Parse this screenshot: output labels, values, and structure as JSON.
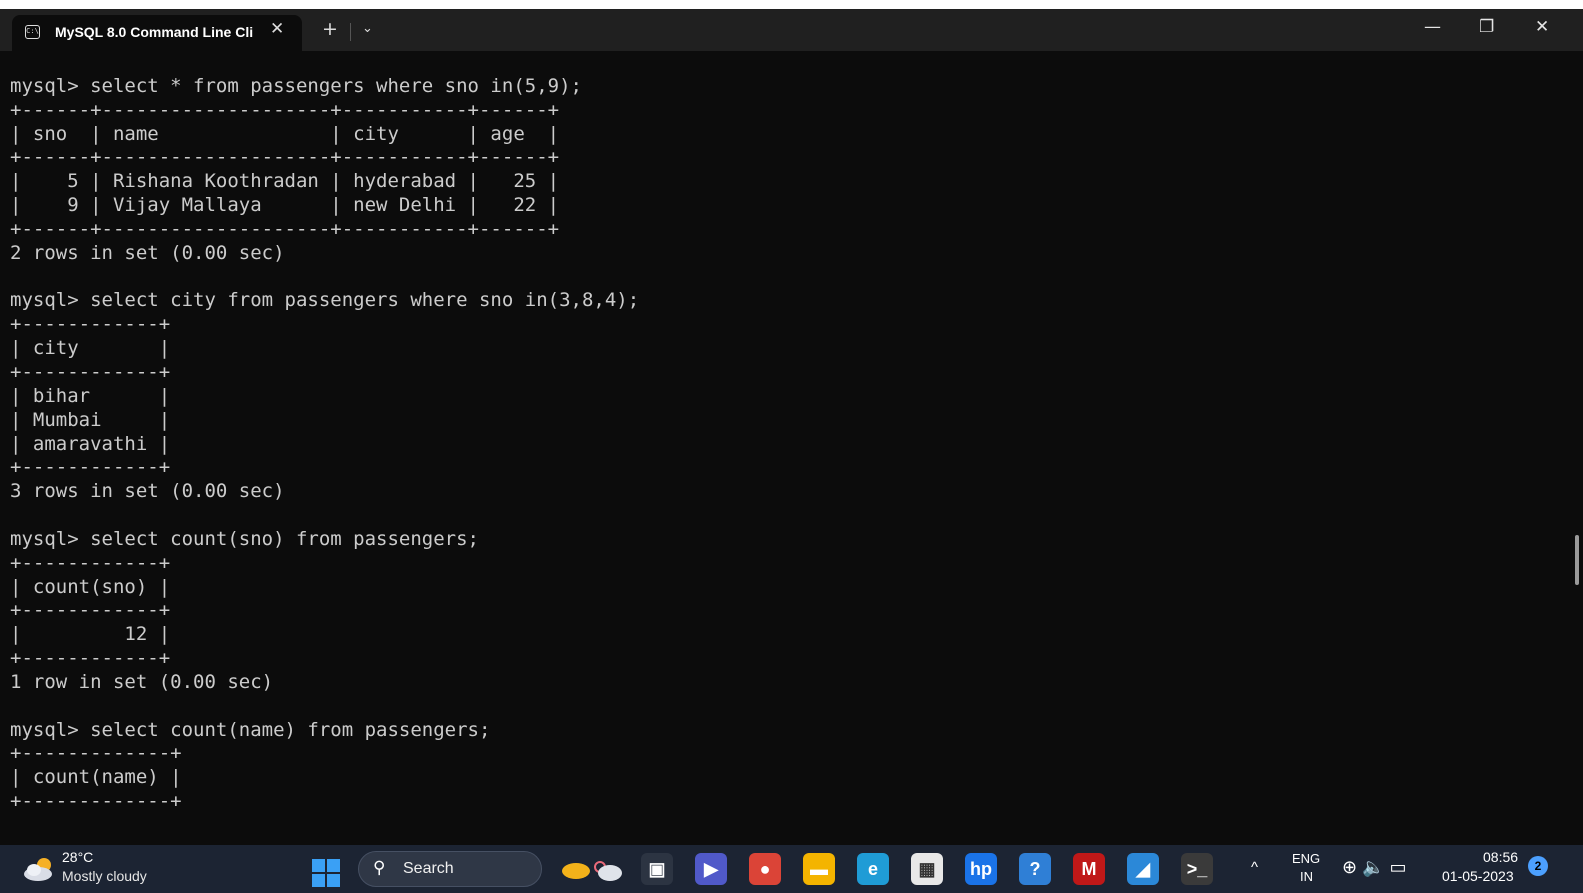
{
  "window": {
    "tab_title": "MySQL 8.0 Command Line Cli",
    "tab_close_glyph": "✕",
    "new_tab_glyph": "+",
    "dropdown_glyph": "⌄",
    "minimize_glyph": "—",
    "restore_glyph": "❐",
    "close_glyph": "✕"
  },
  "terminal": {
    "lines": [
      "",
      "mysql> select * from passengers where sno in(5,9);",
      "+------+--------------------+-----------+------+",
      "| sno  | name               | city      | age  |",
      "+------+--------------------+-----------+------+",
      "|    5 | Rishana Koothradan | hyderabad |   25 |",
      "|    9 | Vijay Mallaya      | new Delhi |   22 |",
      "+------+--------------------+-----------+------+",
      "2 rows in set (0.00 sec)",
      "",
      "mysql> select city from passengers where sno in(3,8,4);",
      "+------------+",
      "| city       |",
      "+------------+",
      "| bihar      |",
      "| Mumbai     |",
      "| amaravathi |",
      "+------------+",
      "3 rows in set (0.00 sec)",
      "",
      "mysql> select count(sno) from passengers;",
      "+------------+",
      "| count(sno) |",
      "+------------+",
      "|         12 |",
      "+------------+",
      "1 row in set (0.00 sec)",
      "",
      "mysql> select count(name) from passengers;",
      "+-------------+",
      "| count(name) |",
      "+-------------+"
    ]
  },
  "taskbar": {
    "weather_temp": "28°C",
    "weather_condition": "Mostly cloudy",
    "search_label": "Search",
    "search_glyph": "⚲",
    "language_top": "ENG",
    "language_bottom": "IN",
    "time": "08:56",
    "date": "01-05-2023",
    "notification_count": "2",
    "chevron_glyph": "^",
    "tray_glyphs": "⊕ 🔈 ▭",
    "pinned_apps": [
      {
        "name": "windows-start",
        "glyph": "",
        "color": "#3aa0f5"
      },
      {
        "name": "task-view",
        "glyph": "▣",
        "color": "#2c3442"
      },
      {
        "name": "teams-meet",
        "glyph": "▶",
        "color": "#5059c9"
      },
      {
        "name": "chrome",
        "glyph": "●",
        "color": "#db4437"
      },
      {
        "name": "file-explorer",
        "glyph": "▬",
        "color": "#f4b400"
      },
      {
        "name": "edge",
        "glyph": "e",
        "color": "#1f9cd6"
      },
      {
        "name": "store",
        "glyph": "▦",
        "color": "#e8e8e8"
      },
      {
        "name": "myhp",
        "glyph": "hp",
        "color": "#1a73e8"
      },
      {
        "name": "get-help",
        "glyph": "?",
        "color": "#2f7fd6"
      },
      {
        "name": "mcafee",
        "glyph": "M",
        "color": "#c01818"
      },
      {
        "name": "photos",
        "glyph": "◢",
        "color": "#2b88d8"
      },
      {
        "name": "terminal",
        "glyph": ">_",
        "color": "#3a3a3a"
      }
    ]
  }
}
